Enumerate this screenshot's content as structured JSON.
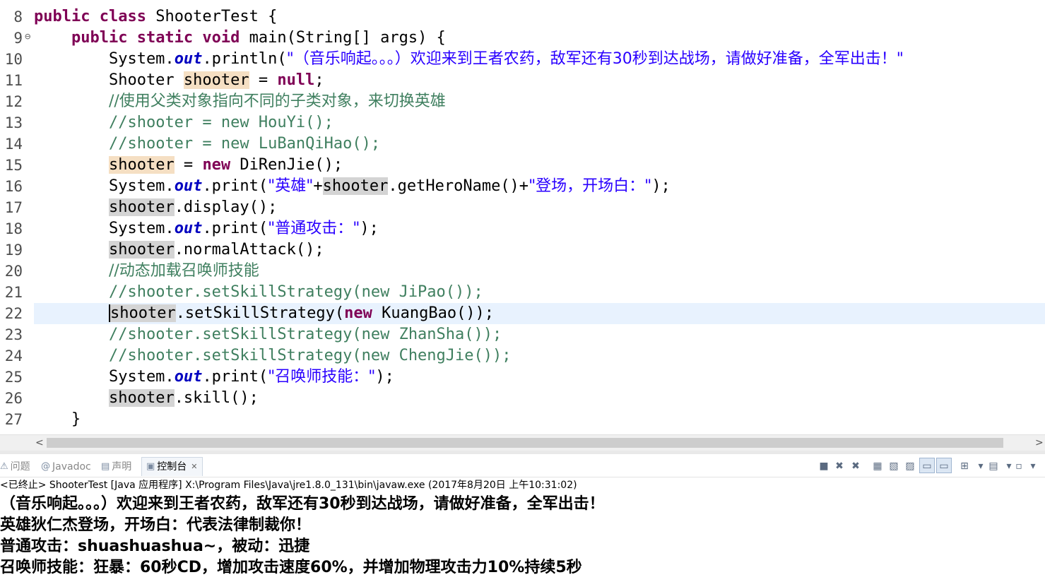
{
  "editor": {
    "lines": [
      {
        "no": "8",
        "segs": [
          {
            "c": "kw",
            "t": "public class"
          },
          {
            "c": "",
            "t": " ShooterTest {"
          }
        ]
      },
      {
        "no": "9",
        "fold": "⊖",
        "segs": [
          {
            "c": "",
            "t": "    "
          },
          {
            "c": "kw",
            "t": "public static void"
          },
          {
            "c": "",
            "t": " main(String[] args) {"
          }
        ]
      },
      {
        "no": "10",
        "segs": [
          {
            "c": "",
            "t": "        System."
          },
          {
            "c": "fld",
            "t": "out"
          },
          {
            "c": "",
            "t": ".println("
          },
          {
            "c": "st",
            "t": "\"（音乐响起。。。）欢迎来到王者农药，敌军还有30秒到达战场，请做好准备，全军出击！\""
          }
        ]
      },
      {
        "no": "11",
        "segs": [
          {
            "c": "",
            "t": "        Shooter "
          },
          {
            "c": "occ",
            "t": "shooter"
          },
          {
            "c": "",
            "t": " = "
          },
          {
            "c": "kw",
            "t": "null"
          },
          {
            "c": "",
            "t": ";"
          }
        ]
      },
      {
        "no": "12",
        "segs": [
          {
            "c": "",
            "t": "        "
          },
          {
            "c": "cmz",
            "t": "//使用父类对象指向不同的子类对象，来切换英雄"
          }
        ]
      },
      {
        "no": "13",
        "segs": [
          {
            "c": "",
            "t": "        "
          },
          {
            "c": "cm",
            "t": "//shooter = new HouYi();"
          }
        ]
      },
      {
        "no": "14",
        "segs": [
          {
            "c": "",
            "t": "        "
          },
          {
            "c": "cm",
            "t": "//shooter = new LuBanQiHao();"
          }
        ]
      },
      {
        "no": "15",
        "segs": [
          {
            "c": "",
            "t": "        "
          },
          {
            "c": "occ",
            "t": "shooter"
          },
          {
            "c": "",
            "t": " = "
          },
          {
            "c": "kw",
            "t": "new"
          },
          {
            "c": "",
            "t": " DiRenJie();"
          }
        ]
      },
      {
        "no": "16",
        "segs": [
          {
            "c": "",
            "t": "        System."
          },
          {
            "c": "fld",
            "t": "out"
          },
          {
            "c": "",
            "t": ".print("
          },
          {
            "c": "st",
            "t": "\"英雄\""
          },
          {
            "c": "",
            "t": "+"
          },
          {
            "c": "ref",
            "t": "shooter"
          },
          {
            "c": "",
            "t": ".getHeroName()+"
          },
          {
            "c": "st",
            "t": "\"登场，开场白：\""
          },
          {
            "c": "",
            "t": ");"
          }
        ]
      },
      {
        "no": "17",
        "segs": [
          {
            "c": "",
            "t": "        "
          },
          {
            "c": "ref",
            "t": "shooter"
          },
          {
            "c": "",
            "t": ".display();"
          }
        ]
      },
      {
        "no": "18",
        "segs": [
          {
            "c": "",
            "t": "        System."
          },
          {
            "c": "fld",
            "t": "out"
          },
          {
            "c": "",
            "t": ".print("
          },
          {
            "c": "st",
            "t": "\"普通攻击：\""
          },
          {
            "c": "",
            "t": ");"
          }
        ]
      },
      {
        "no": "19",
        "segs": [
          {
            "c": "",
            "t": "        "
          },
          {
            "c": "ref",
            "t": "shooter"
          },
          {
            "c": "",
            "t": ".normalAttack();"
          }
        ]
      },
      {
        "no": "20",
        "segs": [
          {
            "c": "",
            "t": "        "
          },
          {
            "c": "cmz",
            "t": "//动态加载召唤师技能"
          }
        ]
      },
      {
        "no": "21",
        "segs": [
          {
            "c": "",
            "t": "        "
          },
          {
            "c": "cm",
            "t": "//shooter.setSkillStrategy(new JiPao());"
          }
        ]
      },
      {
        "no": "22",
        "current": true,
        "segs": [
          {
            "c": "",
            "t": "        "
          },
          {
            "c": "ref caret",
            "t": "shooter"
          },
          {
            "c": "",
            "t": ".setSkillStrategy("
          },
          {
            "c": "kw",
            "t": "new"
          },
          {
            "c": "",
            "t": " KuangBao());"
          }
        ]
      },
      {
        "no": "23",
        "segs": [
          {
            "c": "",
            "t": "        "
          },
          {
            "c": "cm",
            "t": "//shooter.setSkillStrategy(new ZhanSha());"
          }
        ]
      },
      {
        "no": "24",
        "segs": [
          {
            "c": "",
            "t": "        "
          },
          {
            "c": "cm",
            "t": "//shooter.setSkillStrategy(new ChengJie());"
          }
        ]
      },
      {
        "no": "25",
        "segs": [
          {
            "c": "",
            "t": "        System."
          },
          {
            "c": "fld",
            "t": "out"
          },
          {
            "c": "",
            "t": ".print("
          },
          {
            "c": "st",
            "t": "\"召唤师技能：\""
          },
          {
            "c": "",
            "t": ");"
          }
        ]
      },
      {
        "no": "26",
        "segs": [
          {
            "c": "",
            "t": "        "
          },
          {
            "c": "ref",
            "t": "shooter"
          },
          {
            "c": "",
            "t": ".skill();"
          }
        ]
      },
      {
        "no": "27",
        "segs": [
          {
            "c": "",
            "t": "    }"
          }
        ]
      }
    ]
  },
  "panel": {
    "tabs": [
      {
        "label": "问题",
        "icon": "⚠",
        "name": "problems"
      },
      {
        "label": "Javadoc",
        "icon": "@",
        "name": "javadoc"
      },
      {
        "label": "声明",
        "icon": "▤",
        "name": "declaration"
      },
      {
        "label": "控制台",
        "icon": "▣",
        "name": "console",
        "active": true
      }
    ],
    "close_glyph": "✕",
    "status": "<已终止> ShooterTest [Java 应用程序] X:\\Program Files\\Java\\jre1.8.0_131\\bin\\javaw.exe (2017年8月20日 上午10:31:02)",
    "output": [
      "（音乐响起。。。）欢迎来到王者农药，敌军还有30秒到达战场，请做好准备，全军出击！",
      "英雄狄仁杰登场，开场白：代表法律制裁你！",
      "普通攻击：shuashuashua~，被动：迅捷",
      "召唤师技能：狂暴：60秒CD，增加攻击速度60%，并增加物理攻击力10%持续5秒"
    ]
  },
  "toolbar": [
    {
      "icon": "■",
      "name": "terminate-icon"
    },
    {
      "icon": "✖",
      "name": "remove-launch-icon"
    },
    {
      "icon": "✖",
      "name": "remove-all-icon"
    },
    {
      "icon": "▦",
      "name": "clear-console-icon"
    },
    {
      "icon": "▧",
      "name": "scroll-lock-icon"
    },
    {
      "icon": "▨",
      "name": "word-wrap-icon"
    },
    {
      "icon": "▭",
      "name": "show-on-output-icon",
      "pressed": true
    },
    {
      "icon": "▭",
      "name": "show-on-error-icon",
      "pressed": true
    },
    {
      "icon": "⊞",
      "name": "pin-console-icon"
    },
    {
      "icon": "▾",
      "name": "display-console-dropdown-icon"
    },
    {
      "icon": "▤",
      "name": "open-console-icon"
    },
    {
      "icon": "▾",
      "name": "open-console-dropdown-icon"
    },
    {
      "icon": "▫",
      "name": "new-console-icon"
    },
    {
      "icon": "▾",
      "name": "view-menu-icon"
    }
  ],
  "scroll": {
    "left_arrow": "<",
    "right_arrow": ">"
  }
}
